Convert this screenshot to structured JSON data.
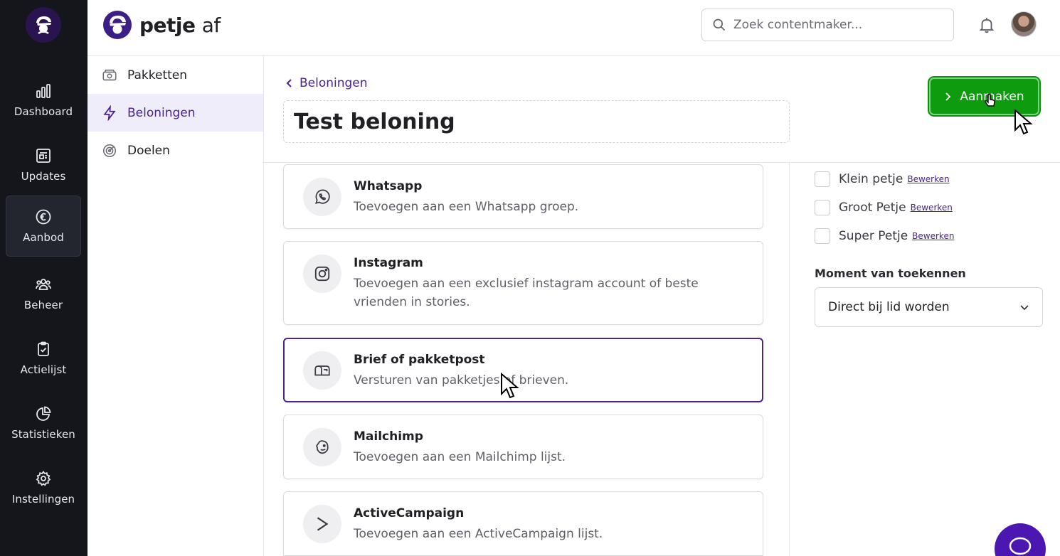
{
  "brand": {
    "name": "petje",
    "suffix": "af"
  },
  "sidebar": {
    "items": [
      {
        "label": "Dashboard",
        "icon": "bar-chart-icon"
      },
      {
        "label": "Updates",
        "icon": "newspaper-icon"
      },
      {
        "label": "Aanbod",
        "icon": "euro-icon"
      },
      {
        "label": "Beheer",
        "icon": "users-icon"
      },
      {
        "label": "Actielijst",
        "icon": "clipboard-check-icon"
      },
      {
        "label": "Statistieken",
        "icon": "pie-chart-icon"
      },
      {
        "label": "Instellingen",
        "icon": "gear-icon"
      }
    ],
    "active": "Aanbod"
  },
  "search": {
    "placeholder": "Zoek contentmaker..."
  },
  "subnav": {
    "items": [
      {
        "label": "Pakketten",
        "icon": "package-icon"
      },
      {
        "label": "Beloningen",
        "icon": "lightning-icon"
      },
      {
        "label": "Doelen",
        "icon": "target-icon"
      }
    ],
    "active": "Beloningen"
  },
  "main": {
    "back_label": "Beloningen",
    "title": "Test beloning",
    "create_label": "Aanmaken",
    "cards": [
      {
        "title": "Whatsapp",
        "desc": "Toevoegen aan een Whatsapp groep.",
        "icon": "whatsapp-icon"
      },
      {
        "title": "Instagram",
        "desc": "Toevoegen aan een exclusief instagram account of beste vrienden in stories.",
        "icon": "instagram-icon"
      },
      {
        "title": "Brief of pakketpost",
        "desc": "Versturen van pakketjes of brieven.",
        "icon": "mailbox-icon"
      },
      {
        "title": "Mailchimp",
        "desc": "Toevoegen aan een Mailchimp lijst.",
        "icon": "mailchimp-icon"
      },
      {
        "title": "ActiveCampaign",
        "desc": "Toevoegen aan een ActiveCampaign lijst.",
        "icon": "activecampaign-icon"
      }
    ],
    "selected_card": "Brief of pakketpost"
  },
  "right_panel": {
    "packages": [
      {
        "label": "Klein petje",
        "edit": "Bewerken"
      },
      {
        "label": "Groot Petje",
        "edit": "Bewerken"
      },
      {
        "label": "Super Petje",
        "edit": "Bewerken"
      }
    ],
    "moment_label": "Moment van toekennen",
    "moment_value": "Direct bij lid worden"
  },
  "colors": {
    "brand_purple": "#4b2391",
    "create_green": "#0e9b0e",
    "sidebar_dark": "#14161c"
  }
}
